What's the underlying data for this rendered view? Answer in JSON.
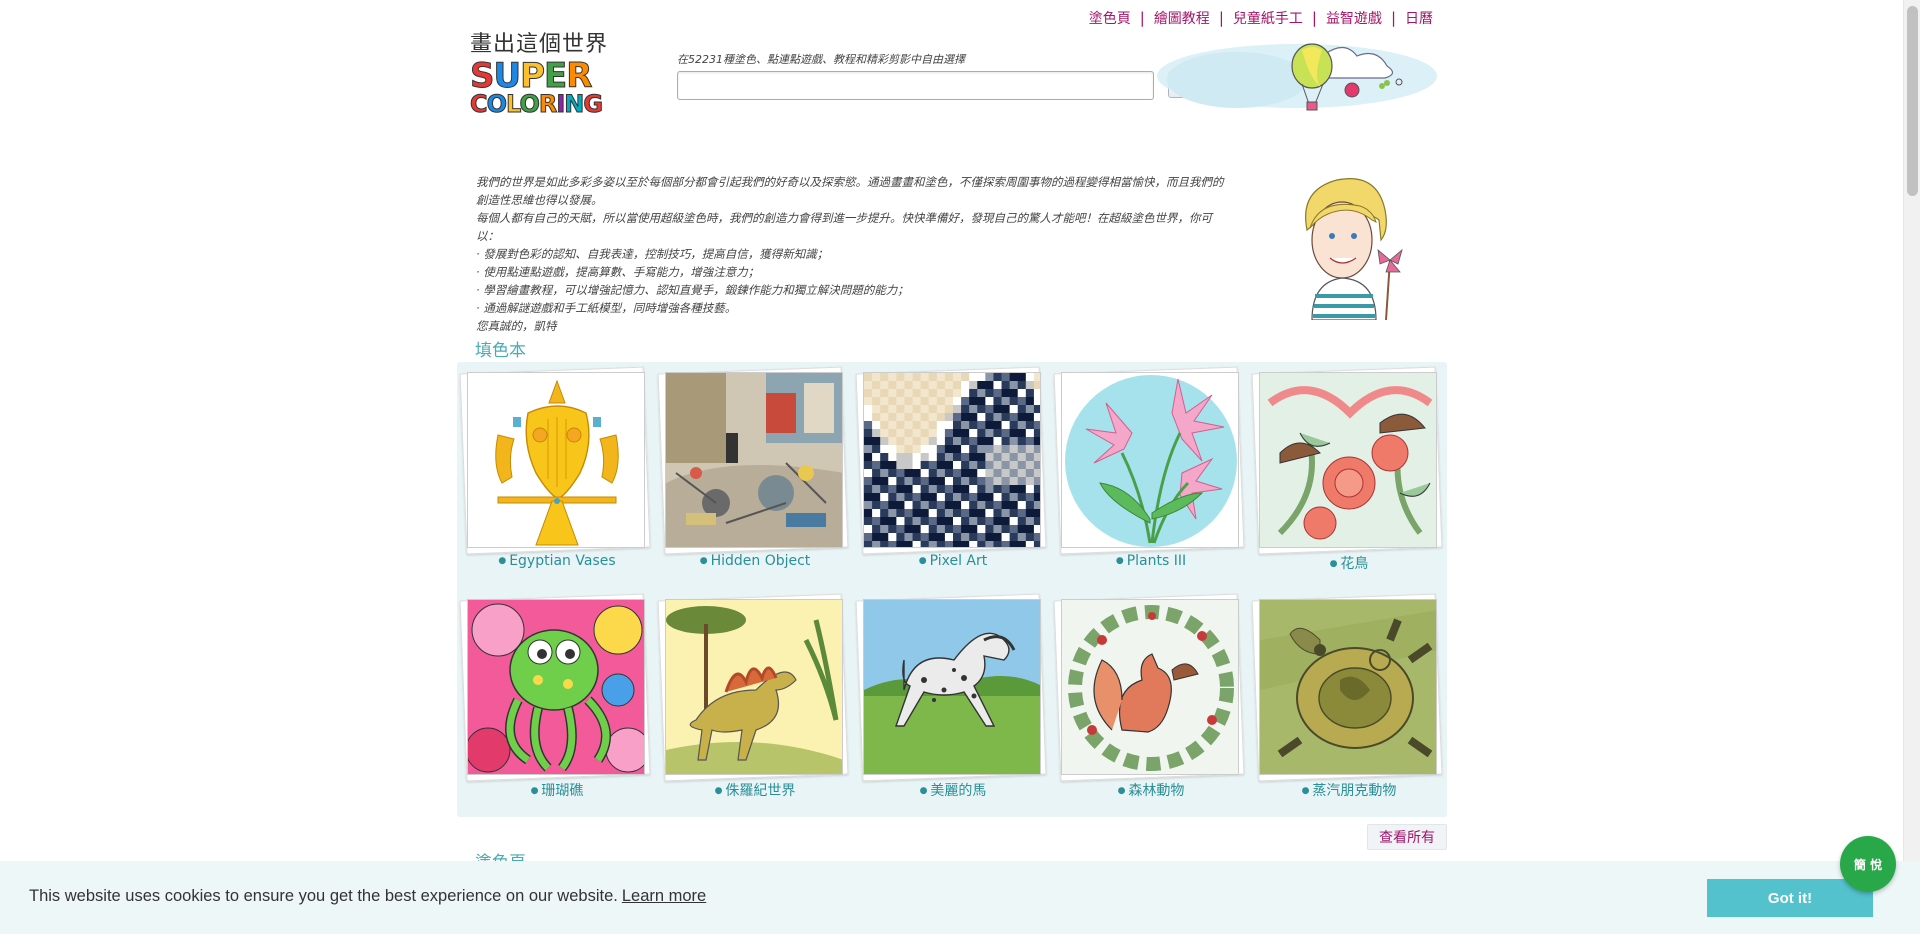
{
  "nav": [
    "塗色頁",
    "繪圖教程",
    "兒童紙手工",
    "益智遊戲",
    "日曆"
  ],
  "logo": {
    "line1": "畫出這個世界",
    "word1": "SUPER",
    "word2": "COLORING"
  },
  "search": {
    "hint": "在52231種塗色、點連點遊戲、教程和精彩剪影中自由選擇",
    "value": "",
    "button_icon": "search-icon"
  },
  "intro": [
    "我們的世界是如此多彩多姿以至於每個部分都會引起我們的好奇以及探索慾。通過畫畫和塗色，不僅探索周圍事物的過程變得相當愉快，而且我們的",
    "創造性思維也得以發展。",
    "每個人都有自己的天賦，所以當使用超級塗色時，我們的創造力會得到進一步提升。快快準備好，發現自己的驚人才能吧！在超級塗色世界，你可",
    "以：",
    "· 發展對色彩的認知、自我表達，控制技巧，提高自信，獲得新知識；",
    "· 使用點連點遊戲，提高算數、手寫能力，增強注意力；",
    "· 學習繪畫教程，可以增強記憶力、認知直覺手，鍛鍊作能力和獨立解決問題的能力；",
    "· 通過解謎遊戲和手工紙模型，同時增強各種技藝。",
    "您真誠的，凱特"
  ],
  "section1_title": "填色本",
  "gallery": [
    {
      "label": "Egyptian Vases"
    },
    {
      "label": "Hidden Object"
    },
    {
      "label": "Pixel Art"
    },
    {
      "label": "Plants III"
    },
    {
      "label": "花鳥"
    },
    {
      "label": "珊瑚礁"
    },
    {
      "label": "侏羅紀世界"
    },
    {
      "label": "美麗的馬"
    },
    {
      "label": "森林動物"
    },
    {
      "label": "蒸汽朋克動物"
    }
  ],
  "view_all": "查看所有",
  "section2_title": "塗色頁",
  "cookie": {
    "message": "This website uses cookies to ensure you get the best experience on our website.",
    "learn_more": "Learn more",
    "accept": "Got it!"
  },
  "lang_button": "簡 悅",
  "colors": {
    "nav": "#a5146a",
    "caption": "#2a8f98",
    "section": "#4aabb3",
    "gallery_bg": "#e9f4f6",
    "cookie_btn": "#53c2cd"
  }
}
